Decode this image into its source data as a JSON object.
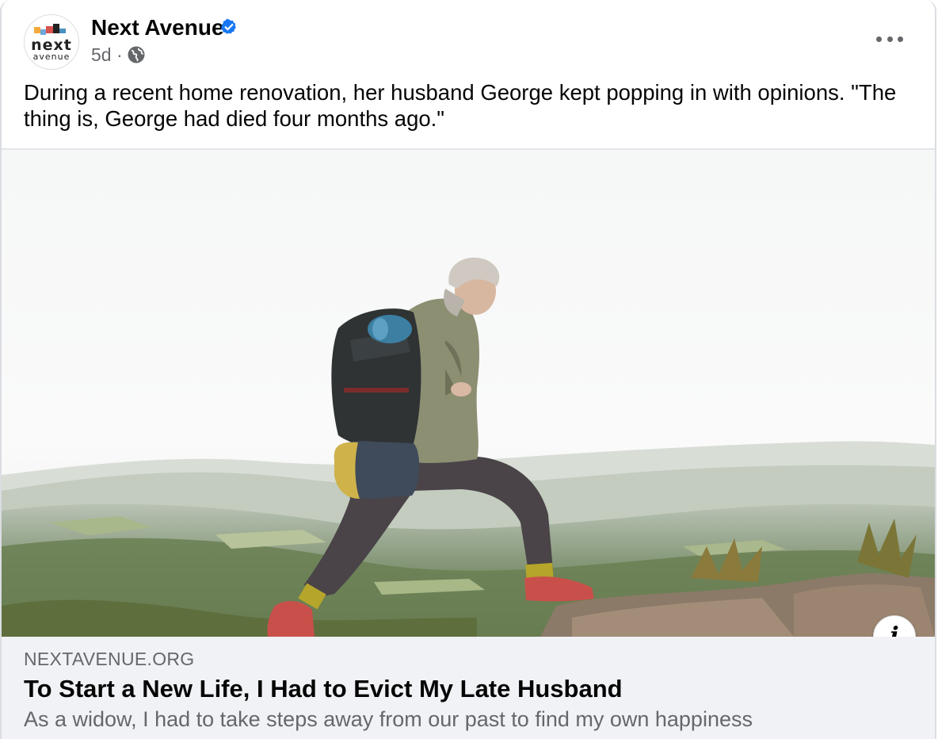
{
  "post": {
    "page_name": "Next Avenue",
    "verified": true,
    "timestamp": "5d",
    "separator": "·",
    "audience_icon": "globe-icon",
    "avatar_logo_top": "next",
    "avatar_logo_bottom": "avenue",
    "more_icon": "more-horizontal-icon",
    "message": "During a recent home renovation, her husband George kept popping in with opinions. \"The thing is, George had died four months ago.\""
  },
  "link_preview": {
    "domain": "NEXTAVENUE.ORG",
    "title": "To Start a New Life, I Had to Evict My Late Husband",
    "description": "As a widow, I had to take steps away from our past to find my own happiness",
    "info_icon": "info-icon",
    "info_glyph": "i"
  },
  "colors": {
    "verified_blue": "#1877f2",
    "secondary_text": "#65676b",
    "link_box_bg": "#f0f2f5"
  }
}
